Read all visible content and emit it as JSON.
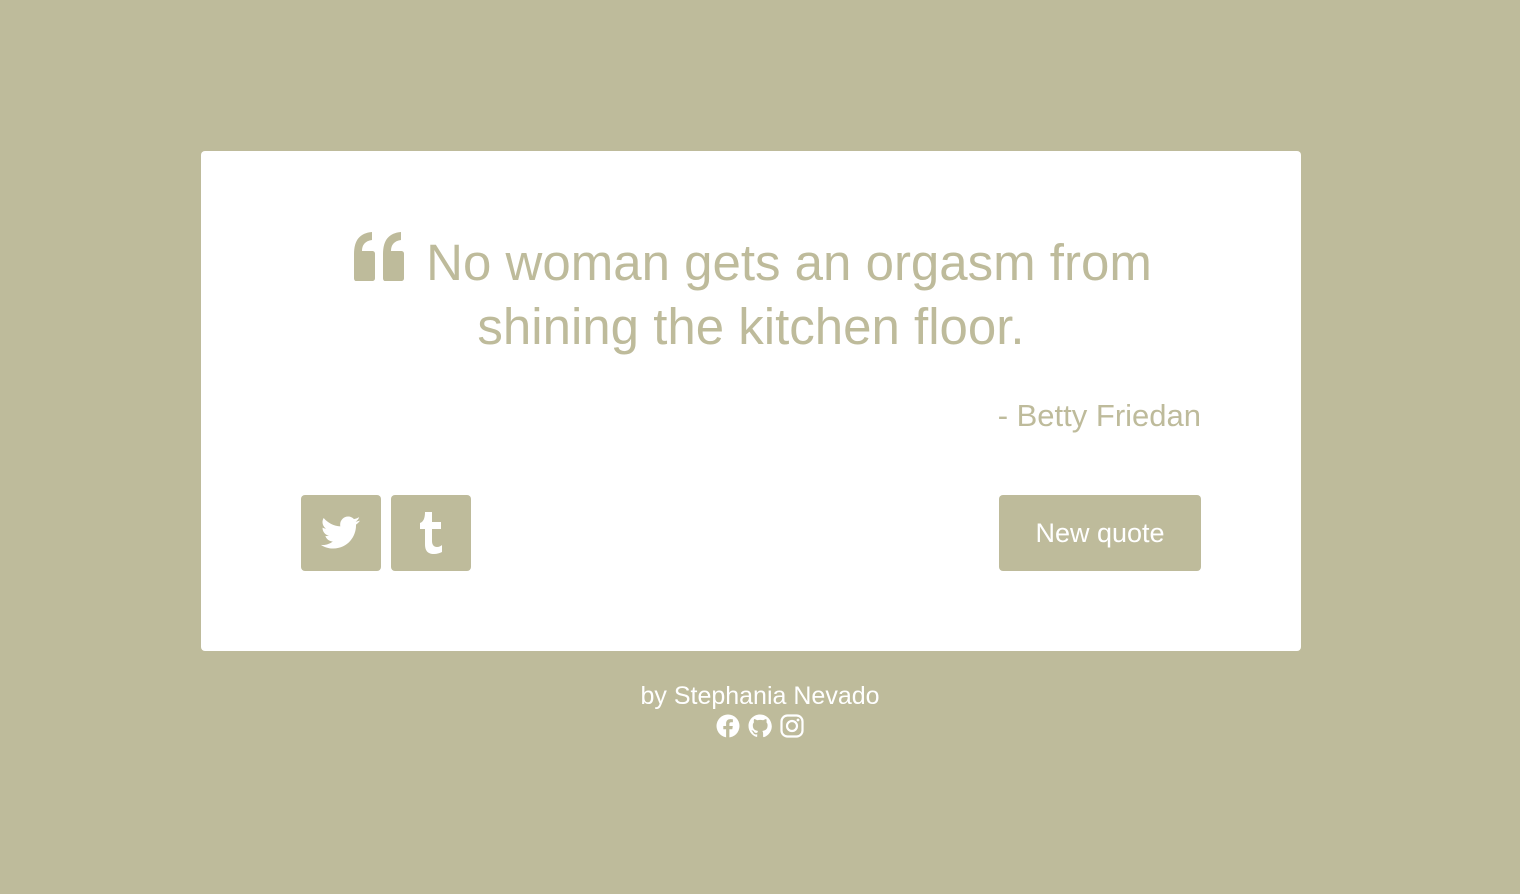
{
  "colors": {
    "background": "#bebb9b",
    "card": "#ffffff",
    "accent": "#bebb9b",
    "text_on_accent": "#ffffff"
  },
  "quote": {
    "icon": "quote-left-icon",
    "text": "No woman gets an orgasm from shining the kitchen floor.",
    "author": "- Betty Friedan"
  },
  "actions": {
    "twitter_icon": "twitter-icon",
    "tumblr_icon": "tumblr-icon",
    "new_quote_label": "New quote"
  },
  "footer": {
    "byline": "by Stephania Nevado",
    "social_icons": [
      "facebook-icon",
      "github-icon",
      "instagram-icon"
    ]
  }
}
